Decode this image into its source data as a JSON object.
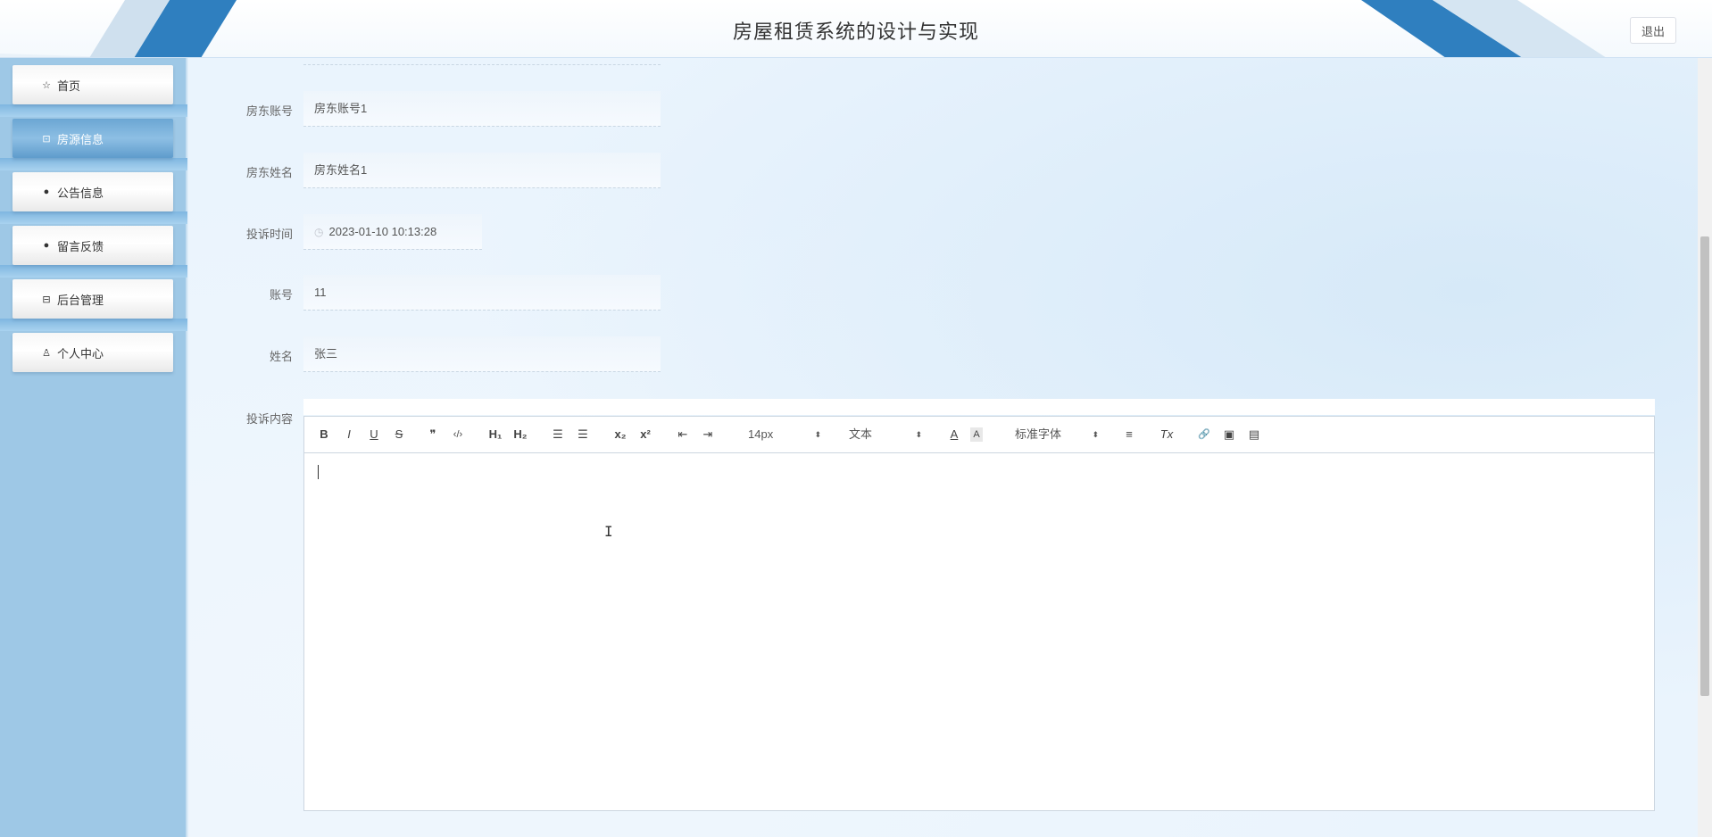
{
  "header": {
    "title": "房屋租赁系统的设计与实现",
    "logout_label": "退出"
  },
  "sidebar": {
    "items": [
      {
        "label": "首页",
        "icon": "star-icon",
        "glyph": "☆",
        "active": false
      },
      {
        "label": "房源信息",
        "icon": "bag-icon",
        "glyph": "⊡",
        "active": true
      },
      {
        "label": "公告信息",
        "icon": "alert-icon",
        "glyph": "●",
        "active": false
      },
      {
        "label": "留言反馈",
        "icon": "question-icon",
        "glyph": "●",
        "active": false
      },
      {
        "label": "后台管理",
        "icon": "briefcase-icon",
        "glyph": "⊟",
        "active": false
      },
      {
        "label": "个人中心",
        "icon": "user-icon",
        "glyph": "♙",
        "active": false
      }
    ]
  },
  "form": {
    "fields": [
      {
        "label": "房东账号",
        "value": "房东账号1"
      },
      {
        "label": "房东姓名",
        "value": "房东姓名1"
      },
      {
        "label": "投诉时间",
        "value": "2023-01-10 10:13:28"
      },
      {
        "label": "账号",
        "value": "11"
      },
      {
        "label": "姓名",
        "value": "张三"
      }
    ],
    "editor_label": "投诉内容"
  },
  "toolbar": {
    "bold": "B",
    "italic": "I",
    "underline": "U",
    "strike": "S",
    "quote": "❞",
    "code": "‹/›",
    "h1": "H₁",
    "h2": "H₂",
    "ordered_list": "☰",
    "bullet_list": "☰",
    "subscript": "x₂",
    "superscript": "x²",
    "outdent": "⇤",
    "indent": "⇥",
    "size_select": "14px",
    "header_select": "文本",
    "color": "A",
    "background": "A",
    "font_select": "标准字体",
    "align": "≡",
    "clean": "Tx",
    "link": "🔗",
    "image": "▣",
    "video": "▤"
  },
  "colors": {
    "sidebar_bg": "#9ec8e6",
    "active_item": "#6ba6d3",
    "header_accent": "#2f7fbf"
  }
}
